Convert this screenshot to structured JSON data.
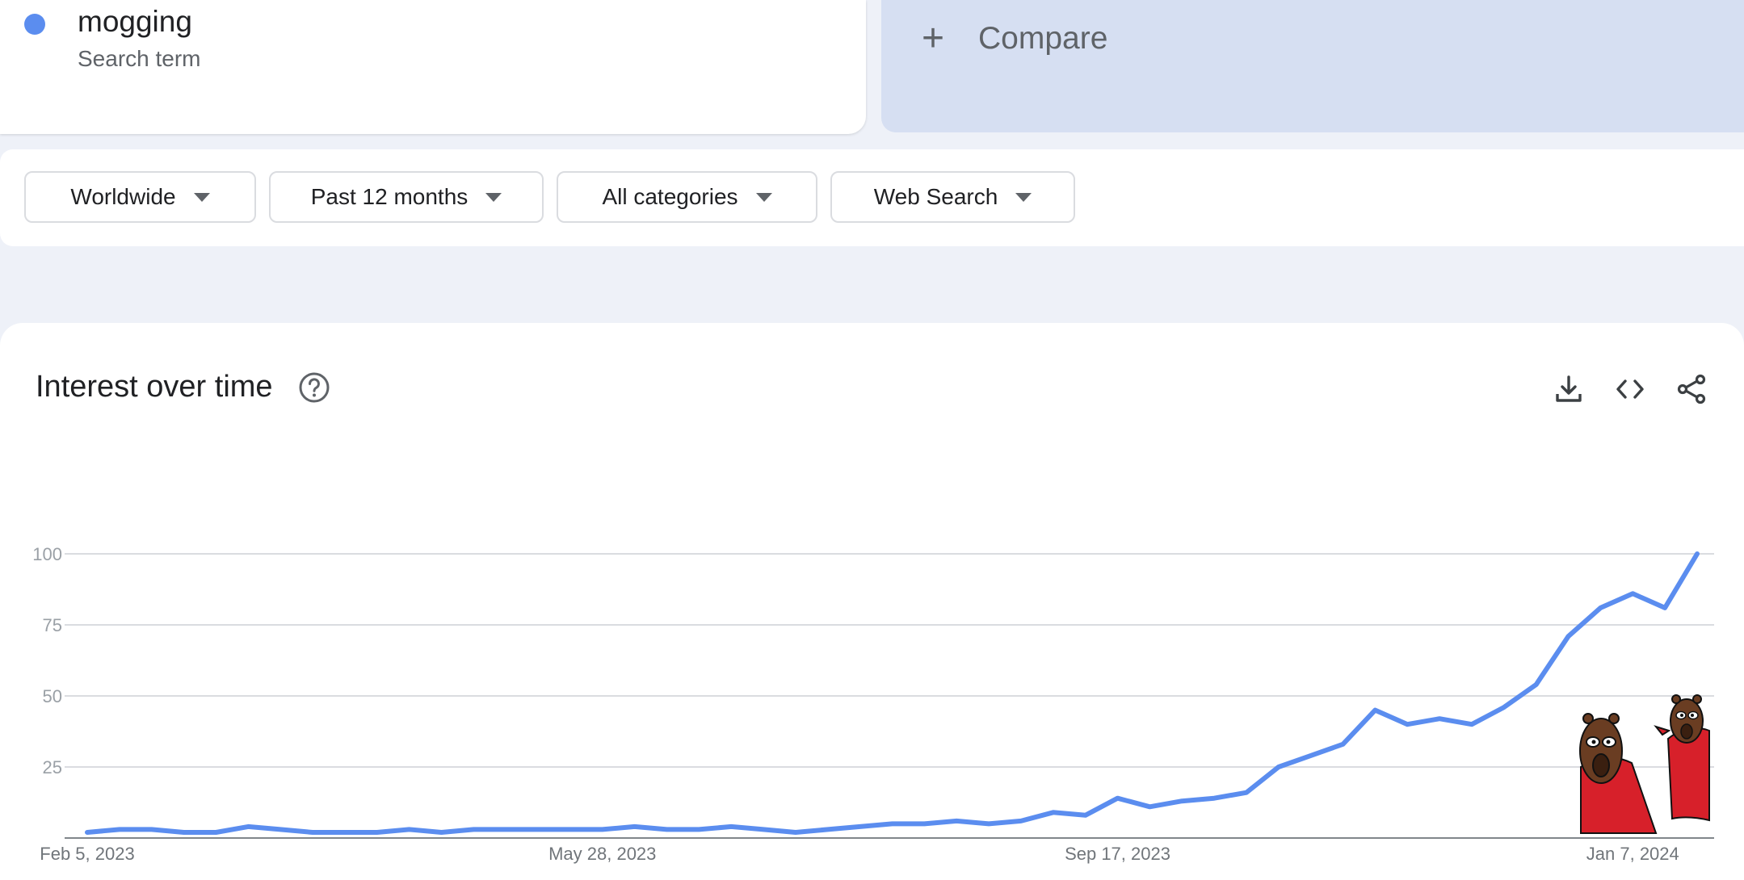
{
  "term": {
    "name": "mogging",
    "subtitle": "Search term",
    "color": "#5b8def"
  },
  "compare": {
    "label": "Compare",
    "icon": "plus-icon"
  },
  "filters": [
    {
      "label": "Worldwide"
    },
    {
      "label": "Past 12 months"
    },
    {
      "label": "All categories"
    },
    {
      "label": "Web Search"
    }
  ],
  "chart": {
    "title": "Interest over time",
    "help_icon": "help-icon",
    "actions": [
      "download-icon",
      "embed-code-icon",
      "share-icon"
    ]
  },
  "chart_data": {
    "type": "line",
    "title": "Interest over time",
    "xlabel": "",
    "ylabel": "",
    "ylim": [
      0,
      100
    ],
    "yticks": [
      25,
      50,
      75,
      100
    ],
    "x_tick_labels": [
      "Feb 5, 2023",
      "May 28, 2023",
      "Sep 17, 2023",
      "Jan 7, 2024"
    ],
    "x_tick_indices": [
      0,
      16,
      32,
      48
    ],
    "grid": true,
    "series": [
      {
        "color": "#5b8def",
        "values": [
          2,
          3,
          3,
          2,
          2,
          4,
          3,
          2,
          2,
          2,
          3,
          2,
          3,
          3,
          3,
          3,
          3,
          4,
          3,
          3,
          4,
          3,
          2,
          3,
          4,
          5,
          5,
          6,
          5,
          6,
          9,
          8,
          14,
          11,
          13,
          14,
          16,
          25,
          29,
          33,
          45,
          40,
          42,
          40,
          46,
          54,
          71,
          81,
          86,
          81,
          100
        ]
      }
    ]
  }
}
